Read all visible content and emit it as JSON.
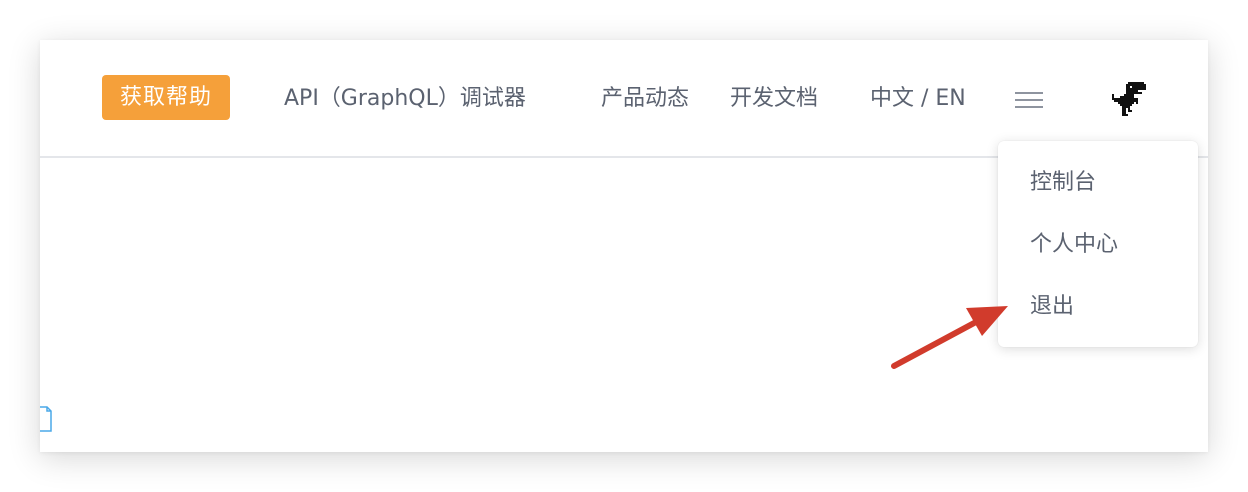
{
  "navbar": {
    "help_button": "获取帮助",
    "links": {
      "api_debugger": "API（GraphQL）调试器",
      "product_news": "产品动态",
      "dev_docs": "开发文档",
      "language": "中文 / EN"
    },
    "menu_icon": "hamburger-icon",
    "avatar_icon": "dinosaur-avatar-icon"
  },
  "dropdown": {
    "items": [
      "控制台",
      "个人中心",
      "退出"
    ]
  },
  "annotation": {
    "arrow_color": "#d13b2c",
    "arrow_target": "退出"
  },
  "colors": {
    "accent": "#f5a03a",
    "text": "#5b6270",
    "border": "#e4e6ea"
  }
}
